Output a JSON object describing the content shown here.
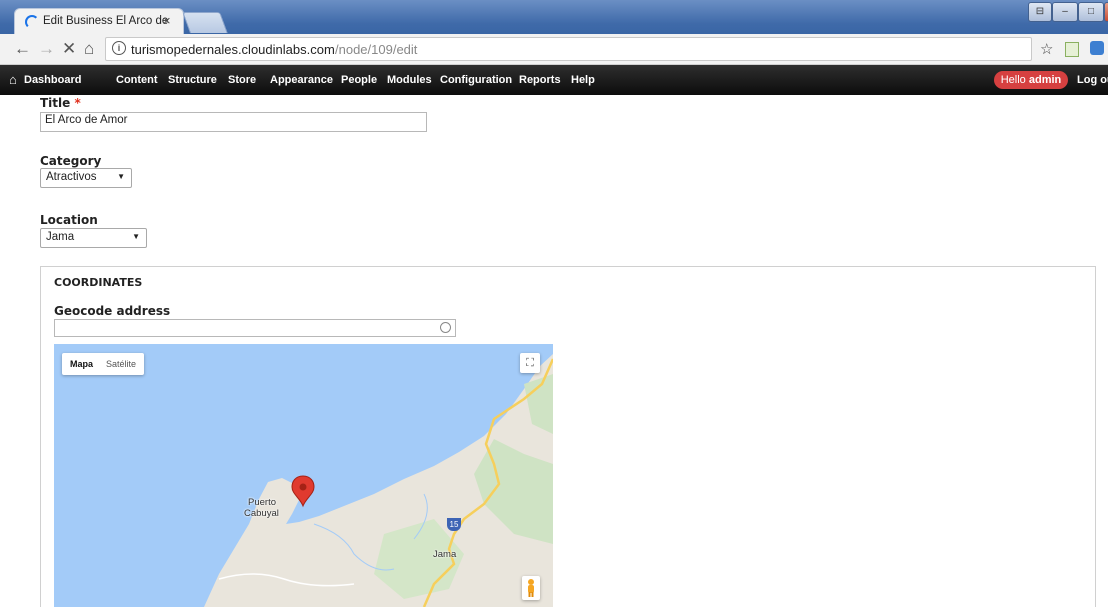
{
  "browser": {
    "tab_title": "Edit Business El Arco de",
    "tab_close": "×",
    "url_host": "turismopedernales.cloudinlabs.com",
    "url_path": "/node/109/edit"
  },
  "toolbar": {
    "items": [
      "Dashboard",
      "Content",
      "Structure",
      "Store",
      "Appearance",
      "People",
      "Modules",
      "Configuration",
      "Reports",
      "Help"
    ],
    "hello_prefix": "Hello",
    "hello_user": "admin",
    "logout": "Log ou"
  },
  "form": {
    "title_label": "Title",
    "required_mark": "*",
    "title_value": "El Arco de Amor",
    "category_label": "Category",
    "category_value": "Atractivos",
    "location_label": "Location",
    "location_value": "Jama",
    "coordinates_legend": "COORDINATES",
    "geocode_label": "Geocode address",
    "geocode_value": ""
  },
  "map": {
    "type_map": "Mapa",
    "type_satellite": "Satélite",
    "place_labels": [
      "Puerto",
      "Cabuyal",
      "Jama"
    ],
    "highway": "15",
    "colors": {
      "water": "#a3cbf8",
      "land": "#e9e5dc",
      "marker": "#e03a2f"
    }
  }
}
